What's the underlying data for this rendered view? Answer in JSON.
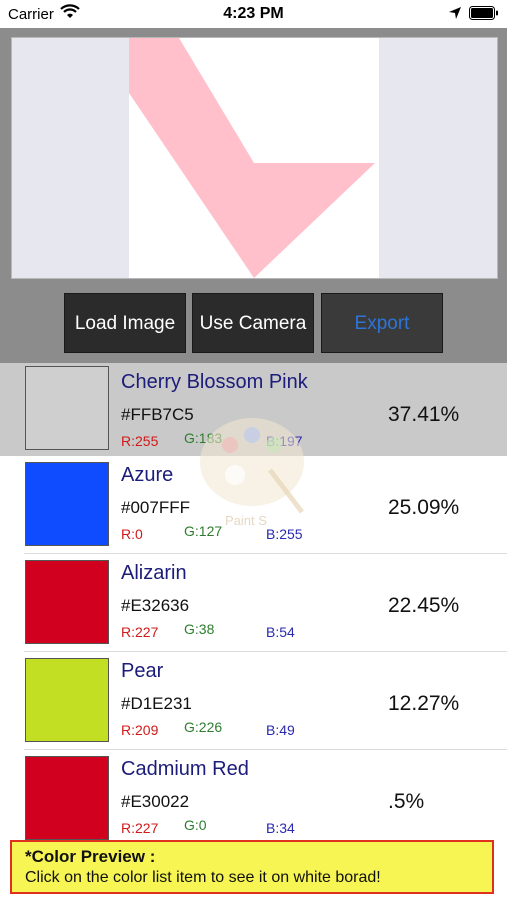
{
  "status_bar": {
    "carrier": "Carrier",
    "time": "4:23 PM"
  },
  "toolbar": {
    "load_label": "Load Image",
    "camera_label": "Use Camera",
    "export_label": "Export"
  },
  "colors": [
    {
      "name": "Cherry Blossom Pink",
      "hex": "#FFB7C5",
      "r": "R:255",
      "g": "G:183",
      "b": "B:197",
      "percent": "37.41%",
      "swatch": "#cfcfcf",
      "selected": true
    },
    {
      "name": "Azure",
      "hex": "#007FFF",
      "r": "R:0",
      "g": "G:127",
      "b": "B:255",
      "percent": "25.09%",
      "swatch": "#0f4bff",
      "selected": false
    },
    {
      "name": "Alizarin",
      "hex": "#E32636",
      "r": "R:227",
      "g": "G:38",
      "b": "B:54",
      "percent": "22.45%",
      "swatch": "#d0001e",
      "selected": false
    },
    {
      "name": "Pear",
      "hex": "#D1E231",
      "r": "R:209",
      "g": "G:226",
      "b": "B:49",
      "percent": "12.27%",
      "swatch": "#c2df23",
      "selected": false
    },
    {
      "name": "Cadmium Red",
      "hex": "#E30022",
      "r": "R:227",
      "g": "G:0",
      "b": "B:34",
      "percent": ".5%",
      "swatch": "#d0001e",
      "selected": false
    }
  ],
  "watermark": {
    "label": "Paint S"
  },
  "preview": {
    "title": "*Color Preview :",
    "text": "Click on the color list item to see it  on white borad!"
  },
  "canvas_shape_color": "#ffc0cb"
}
